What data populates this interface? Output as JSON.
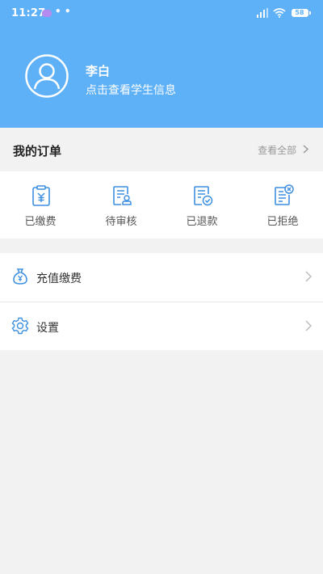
{
  "status_bar": {
    "time": "11:27",
    "dots": "• •",
    "battery": "58"
  },
  "profile": {
    "name": "李白",
    "subtitle": "点击查看学生信息"
  },
  "orders": {
    "title": "我的订单",
    "view_all": "查看全部",
    "items": [
      {
        "label": "已缴费",
        "icon": "paid-clipboard-icon"
      },
      {
        "label": "待审核",
        "icon": "pending-review-icon"
      },
      {
        "label": "已退款",
        "icon": "refunded-icon"
      },
      {
        "label": "已拒绝",
        "icon": "rejected-icon"
      }
    ]
  },
  "menu": [
    {
      "label": "充值缴费",
      "icon": "money-bag-icon"
    },
    {
      "label": "设置",
      "icon": "settings-gear-icon"
    }
  ],
  "colors": {
    "header_bg": "#5eb0f7",
    "icon_blue": "#3d8fe0",
    "page_bg": "#f2f2f2"
  }
}
